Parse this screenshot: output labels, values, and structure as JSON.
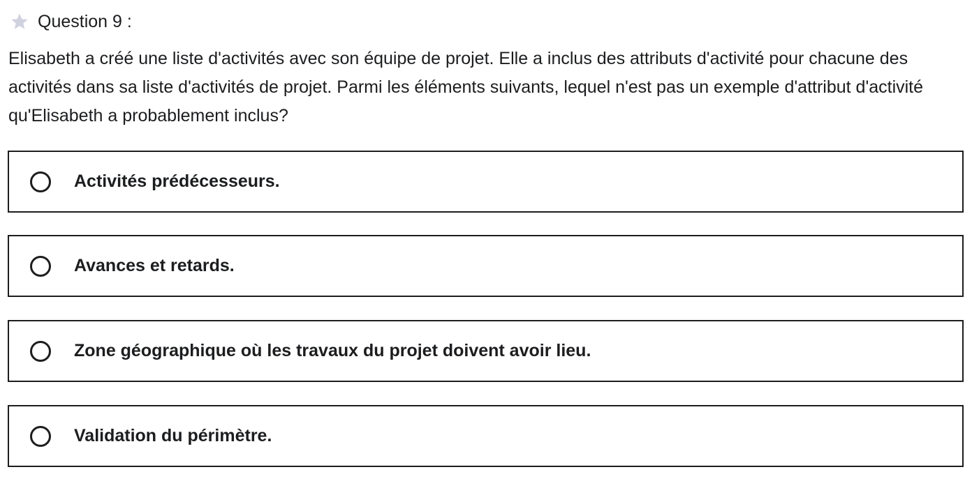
{
  "question": {
    "star_icon": "star-icon",
    "star_color": "#d1d2e0",
    "label": "Question 9 :",
    "text": "Elisabeth a créé une liste d'activités avec son équipe de projet. Elle a inclus des attributs d'activité pour chacune des activités dans sa liste d'activités de projet. Parmi les éléments suivants, lequel n'est pas un exemple d'attribut d'activité qu'Elisabeth a probablement inclus?"
  },
  "options": [
    {
      "label": "Activités prédécesseurs.",
      "selected": false
    },
    {
      "label": "Avances et retards.",
      "selected": false
    },
    {
      "label": "Zone géographique où les travaux du projet doivent avoir lieu.",
      "selected": false
    },
    {
      "label": "Validation du périmètre.",
      "selected": false
    }
  ],
  "colors": {
    "text": "#1c1d1f",
    "border": "#1c1d1f",
    "background": "#ffffff"
  }
}
